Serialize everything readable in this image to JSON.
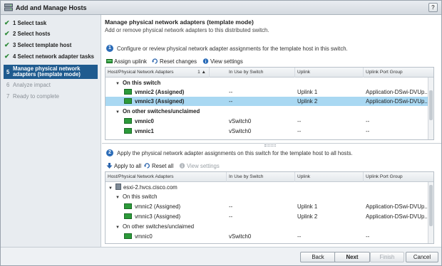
{
  "window": {
    "title": "Add and Manage Hosts",
    "help_label": "?"
  },
  "steps": [
    {
      "num": "1",
      "label": "Select task",
      "state": "done"
    },
    {
      "num": "2",
      "label": "Select hosts",
      "state": "done"
    },
    {
      "num": "3",
      "label": "Select template host",
      "state": "done"
    },
    {
      "num": "4",
      "label": "Select network adapter tasks",
      "state": "done"
    },
    {
      "num": "5",
      "label": "Manage physical network adapters (template mode)",
      "state": "active"
    },
    {
      "num": "6",
      "label": "Analyze impact",
      "state": "disabled"
    },
    {
      "num": "7",
      "label": "Ready to complete",
      "state": "disabled"
    }
  ],
  "main": {
    "heading": "Manage physical network adapters (template mode)",
    "subheading": "Add or remove physical network adapters to this distributed switch."
  },
  "section1": {
    "badge": "1",
    "instruction": "Configure or review physical network adapter assignments for the template host in this switch.",
    "toolbar": {
      "assign": "Assign uplink",
      "reset": "Reset changes",
      "view": "View settings"
    },
    "columns": [
      "Host/Physical Network Adapters",
      "1 ▲",
      "In Use by Switch",
      "Uplink",
      "Uplink Port Group"
    ],
    "rows": [
      {
        "type": "group",
        "name": "On this switch"
      },
      {
        "type": "nic",
        "name": "vmnic2 (Assigned)",
        "in_use": "--",
        "uplink": "Uplink 1",
        "port_group": "Application-DSwi-DVUp...",
        "selected": false
      },
      {
        "type": "nic",
        "name": "vmnic3 (Assigned)",
        "in_use": "--",
        "uplink": "Uplink 2",
        "port_group": "Application-DSwi-DVUp...",
        "selected": true
      },
      {
        "type": "group",
        "name": "On other switches/unclaimed"
      },
      {
        "type": "nic",
        "name": "vmnic0",
        "in_use": "vSwitch0",
        "uplink": "--",
        "port_group": "--",
        "selected": false
      },
      {
        "type": "nic",
        "name": "vmnic1",
        "in_use": "vSwitch0",
        "uplink": "--",
        "port_group": "--",
        "selected": false
      }
    ]
  },
  "section2": {
    "badge": "2",
    "instruction": "Apply the physical network adapter assignments on this switch for the template host to all hosts.",
    "toolbar": {
      "apply": "Apply to all",
      "reset": "Reset all",
      "view": "View settings"
    },
    "columns": [
      "Host/Physical Network Adapters",
      "In Use by Switch",
      "Uplink",
      "Uplink Port Group"
    ],
    "host": "esxi-2.hvcs.cisco.com",
    "rows": [
      {
        "type": "group",
        "name": "On this switch"
      },
      {
        "type": "nic",
        "name": "vmnic2 (Assigned)",
        "in_use": "--",
        "uplink": "Uplink 1",
        "port_group": "Application-DSwi-DVUp..."
      },
      {
        "type": "nic",
        "name": "vmnic3 (Assigned)",
        "in_use": "--",
        "uplink": "Uplink 2",
        "port_group": "Application-DSwi-DVUp..."
      },
      {
        "type": "group",
        "name": "On other switches/unclaimed"
      },
      {
        "type": "nic",
        "name": "vmnic0",
        "in_use": "vSwitch0",
        "uplink": "--",
        "port_group": "--"
      }
    ]
  },
  "footer": {
    "back": "Back",
    "next": "Next",
    "finish": "Finish",
    "cancel": "Cancel"
  },
  "colors": {
    "accent": "#1f5b8f",
    "selection": "#a9d8f2",
    "check": "#2e8b3a",
    "nic": "#2c9a3a"
  }
}
